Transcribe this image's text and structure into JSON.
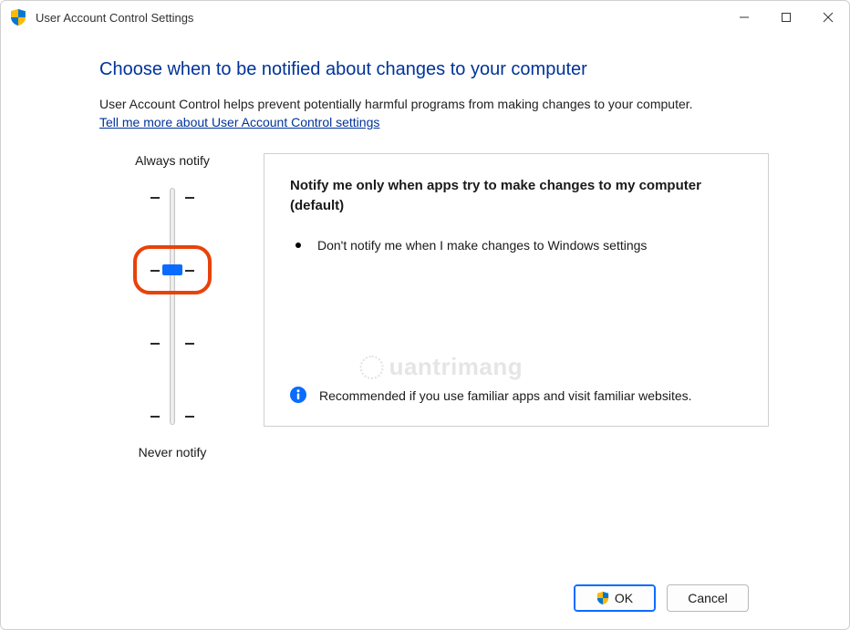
{
  "window": {
    "title": "User Account Control Settings"
  },
  "heading": "Choose when to be notified about changes to your computer",
  "description": "User Account Control helps prevent potentially harmful programs from making changes to your computer.",
  "link_text": "Tell me more about User Account Control settings",
  "slider": {
    "top_label": "Always notify",
    "bottom_label": "Never notify",
    "levels": 4,
    "selected_index": 1
  },
  "panel": {
    "title": "Notify me only when apps try to make changes to my computer (default)",
    "bullet": "Don't notify me when I make changes to Windows settings",
    "recommendation": "Recommended if you use familiar apps and visit familiar websites."
  },
  "buttons": {
    "ok": "OK",
    "cancel": "Cancel"
  },
  "watermark": "uantrimang"
}
